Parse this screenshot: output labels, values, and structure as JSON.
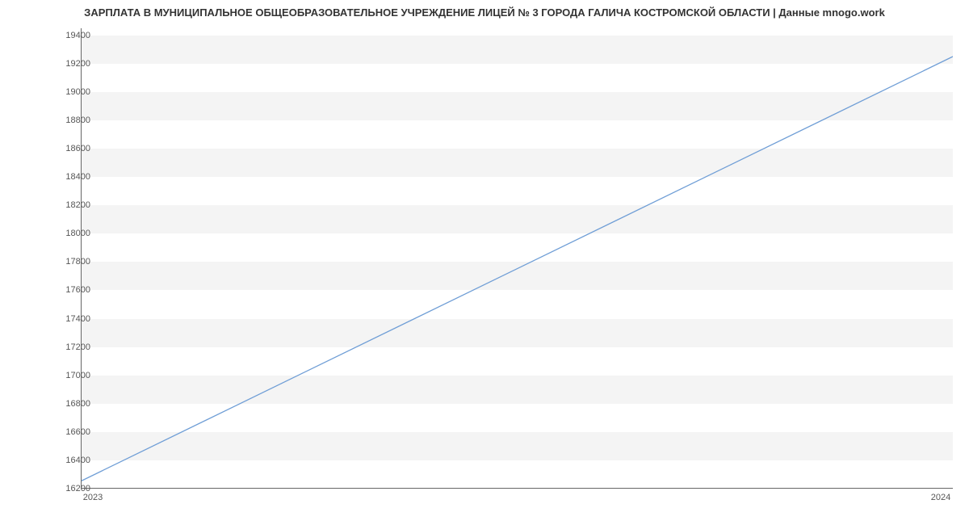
{
  "chart_data": {
    "type": "line",
    "title": "ЗАРПЛАТА В МУНИЦИПАЛЬНОЕ ОБЩЕОБРАЗОВАТЕЛЬНОЕ УЧРЕЖДЕНИЕ ЛИЦЕЙ № 3 ГОРОДА ГАЛИЧА КОСТРОМСКОЙ ОБЛАСТИ | Данные mnogo.work",
    "xlabel": "",
    "ylabel": "",
    "ylim": [
      16200,
      19450
    ],
    "xlim": [
      2023,
      2024
    ],
    "x_ticks": [
      2023,
      2024
    ],
    "y_ticks": [
      16200,
      16400,
      16600,
      16800,
      17000,
      17200,
      17400,
      17600,
      17800,
      18000,
      18200,
      18400,
      18600,
      18800,
      19000,
      19200,
      19400
    ],
    "x": [
      2023,
      2024
    ],
    "values": [
      16250,
      19250
    ],
    "line_color": "#6f9ed6"
  }
}
